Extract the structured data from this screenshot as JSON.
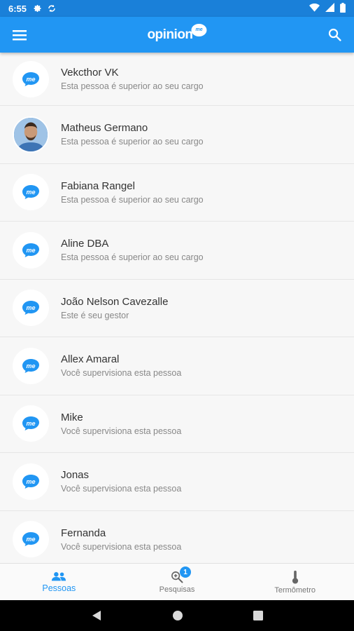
{
  "status_bar": {
    "time": "6:55"
  },
  "app_bar": {
    "logo_text": "opinion",
    "logo_badge": "me"
  },
  "people": [
    {
      "name": "Vekcthor VK",
      "relation": "Esta pessoa é superior ao seu cargo",
      "avatar": "me-logo"
    },
    {
      "name": "Matheus Germano",
      "relation": "Esta pessoa é superior ao seu cargo",
      "avatar": "photo"
    },
    {
      "name": "Fabiana Rangel",
      "relation": "Esta pessoa é superior ao seu cargo",
      "avatar": "me-logo"
    },
    {
      "name": "Aline DBA",
      "relation": "Esta pessoa é superior ao seu cargo",
      "avatar": "me-logo"
    },
    {
      "name": "João Nelson Cavezalle",
      "relation": "Este é seu gestor",
      "avatar": "me-logo"
    },
    {
      "name": "Allex Amaral",
      "relation": "Você supervisiona esta pessoa",
      "avatar": "me-logo"
    },
    {
      "name": "Mike",
      "relation": "Você supervisiona esta pessoa",
      "avatar": "me-logo"
    },
    {
      "name": "Jonas",
      "relation": "Você supervisiona esta pessoa",
      "avatar": "me-logo"
    },
    {
      "name": "Fernanda",
      "relation": "Você supervisiona esta pessoa",
      "avatar": "me-logo"
    }
  ],
  "bottom_nav": {
    "tabs": [
      {
        "label": "Pessoas",
        "icon": "people-icon",
        "active": true
      },
      {
        "label": "Pesquisas",
        "icon": "search-zoom-icon",
        "badge": "1"
      },
      {
        "label": "Termômetro",
        "icon": "thermometer-icon"
      }
    ]
  },
  "colors": {
    "primary": "#2196f3",
    "status_bar": "#1a80d9"
  }
}
